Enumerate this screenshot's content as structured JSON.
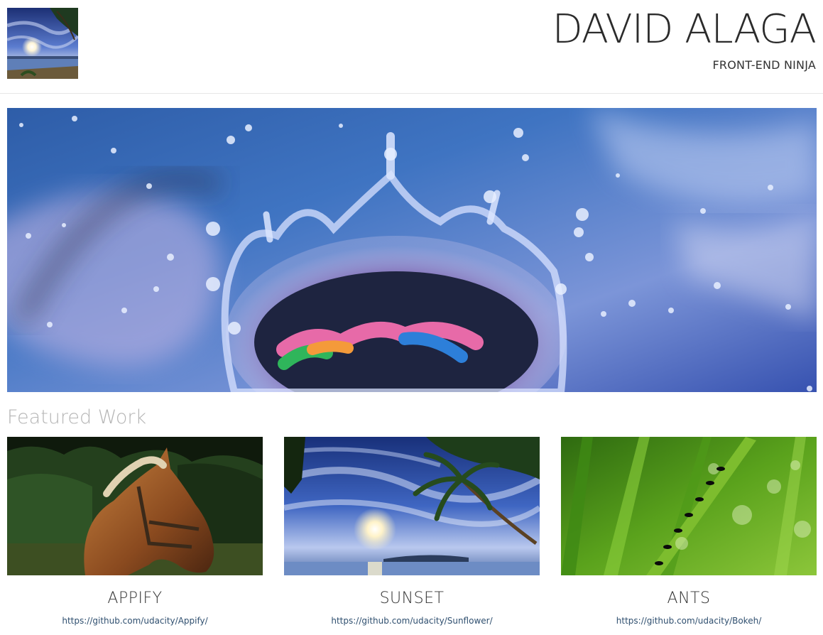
{
  "header": {
    "title": "DAVID ALAGA",
    "tagline": "FRONT-END NINJA"
  },
  "featured": {
    "heading": "Featured Work",
    "items": [
      {
        "title": "APPIFY",
        "link": "https://github.com/udacity/Appify/"
      },
      {
        "title": "SUNSET",
        "link": "https://github.com/udacity/Sunflower/"
      },
      {
        "title": "ANTS",
        "link": "https://github.com/udacity/Bokeh/"
      }
    ]
  },
  "colors": {
    "title_text": "#2b2b2b",
    "section_heading": "#b5b5b5",
    "link": "#2f4f6f",
    "divider": "#e6e6e6"
  }
}
